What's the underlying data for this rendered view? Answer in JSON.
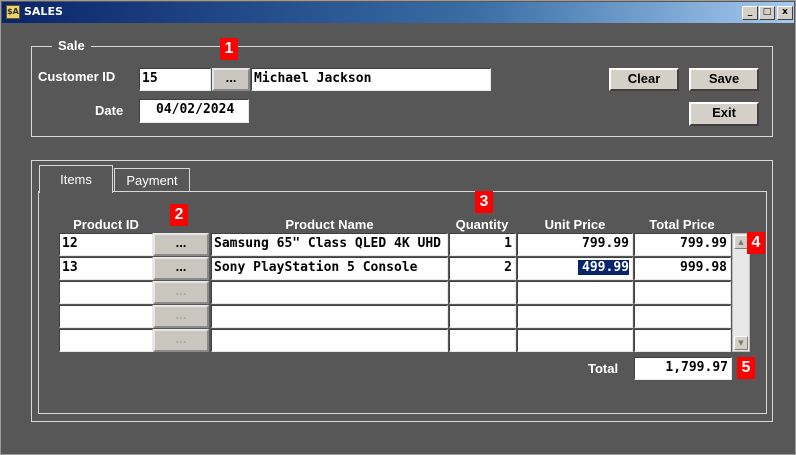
{
  "window": {
    "title": "SALES",
    "controls": [
      "_",
      "□",
      "x"
    ]
  },
  "sale_group": {
    "legend": "Sale",
    "customer_id_label": "Customer ID",
    "customer_id": "15",
    "customer_lookup": "...",
    "customer_name": "Michael Jackson",
    "date_label": "Date",
    "date": "04/02/2024"
  },
  "buttons": {
    "clear": "Clear",
    "save": "Save",
    "exit": "Exit"
  },
  "tabs": [
    {
      "label": "Items",
      "active": true
    },
    {
      "label": "Payment",
      "active": false
    }
  ],
  "grid": {
    "headers": {
      "product_id": "Product ID",
      "product_name": "Product Name",
      "quantity": "Quantity",
      "unit_price": "Unit Price",
      "total_price": "Total Price"
    },
    "lookup_label": "...",
    "rows": [
      {
        "product_id": "12",
        "product_name": "Samsung 65\" Class QLED 4K UHD",
        "quantity": "1",
        "unit_price": "799.99",
        "total_price": "799.99"
      },
      {
        "product_id": "13",
        "product_name": "Sony PlayStation 5 Console",
        "quantity": "2",
        "unit_price": "499.99",
        "total_price": "999.98"
      },
      {
        "product_id": "",
        "product_name": "",
        "quantity": "",
        "unit_price": "",
        "total_price": ""
      },
      {
        "product_id": "",
        "product_name": "",
        "quantity": "",
        "unit_price": "",
        "total_price": ""
      },
      {
        "product_id": "",
        "product_name": "",
        "quantity": "",
        "unit_price": "",
        "total_price": ""
      }
    ]
  },
  "total": {
    "label": "Total",
    "value": "1,799.97"
  },
  "markers": [
    "1",
    "2",
    "3",
    "4",
    "5"
  ],
  "colors": {
    "window_bg": "#575757",
    "title_bar": "#0a246a",
    "marker": "#ff0000",
    "selection": "#0a246a"
  }
}
